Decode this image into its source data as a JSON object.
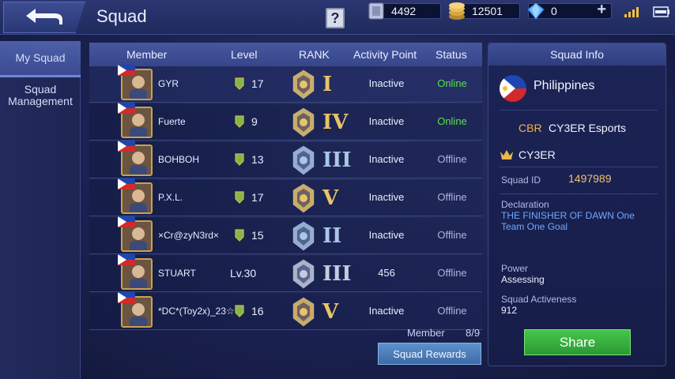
{
  "header": {
    "title": "Squad",
    "help_label": "?",
    "resources": [
      {
        "name": "ticket",
        "value": "4492"
      },
      {
        "name": "battle-points",
        "value": "12501"
      },
      {
        "name": "diamonds",
        "value": "0"
      }
    ],
    "add_label": "+"
  },
  "nav": {
    "items": [
      {
        "label": "My Squad",
        "active": true
      },
      {
        "label": "Squad Management",
        "active": false
      }
    ]
  },
  "table": {
    "headers": [
      "Member",
      "Level",
      "RANK",
      "Activity Point",
      "Status"
    ],
    "rows": [
      {
        "name": "GYR",
        "level": "17",
        "rank": "I",
        "rank_tier": "gold",
        "activity": "Inactive",
        "status": "Online"
      },
      {
        "name": "Fuerte",
        "level": "9",
        "rank": "IV",
        "rank_tier": "gold",
        "activity": "Inactive",
        "status": "Online"
      },
      {
        "name": "BOHBOH",
        "level": "13",
        "rank": "III",
        "rank_tier": "silver",
        "activity": "Inactive",
        "status": "Offline"
      },
      {
        "name": "P.X.L.",
        "level": "17",
        "rank": "V",
        "rank_tier": "gold",
        "activity": "Inactive",
        "status": "Offline"
      },
      {
        "name": "×Cr@zyN3rd×",
        "level": "15",
        "rank": "II",
        "rank_tier": "silver",
        "activity": "Inactive",
        "status": "Offline"
      },
      {
        "name": "STUART",
        "level": "Lv.30",
        "rank": "III",
        "rank_tier": "steel",
        "activity": "456",
        "status": "Offline"
      },
      {
        "name": "*DC*(Toy2x)_23☆",
        "level": "16",
        "rank": "V",
        "rank_tier": "gold",
        "activity": "Inactive",
        "status": "Offline"
      }
    ],
    "member_label": "Member",
    "member_count": "8/9",
    "rewards_label": "Squad Rewards"
  },
  "info": {
    "title": "Squad Info",
    "country": "Philippines",
    "tag": "CBR",
    "squad_name": "CY3ER Esports",
    "leader": "CY3ER",
    "id_label": "Squad ID",
    "id_value": "1497989",
    "declaration_label": "Declaration",
    "declaration": "THE FINISHER OF DAWN One Team One Goal",
    "power_label": "Power",
    "power_value": "Assessing",
    "activeness_label": "Squad Activeness",
    "activeness_value": "912",
    "share_label": "Share"
  },
  "colors": {
    "online": "#56e04e",
    "offline": "#a9b5dc",
    "gold": "#e9c468",
    "silver": "#a9c6e6",
    "steel": "#c4ccdd"
  }
}
